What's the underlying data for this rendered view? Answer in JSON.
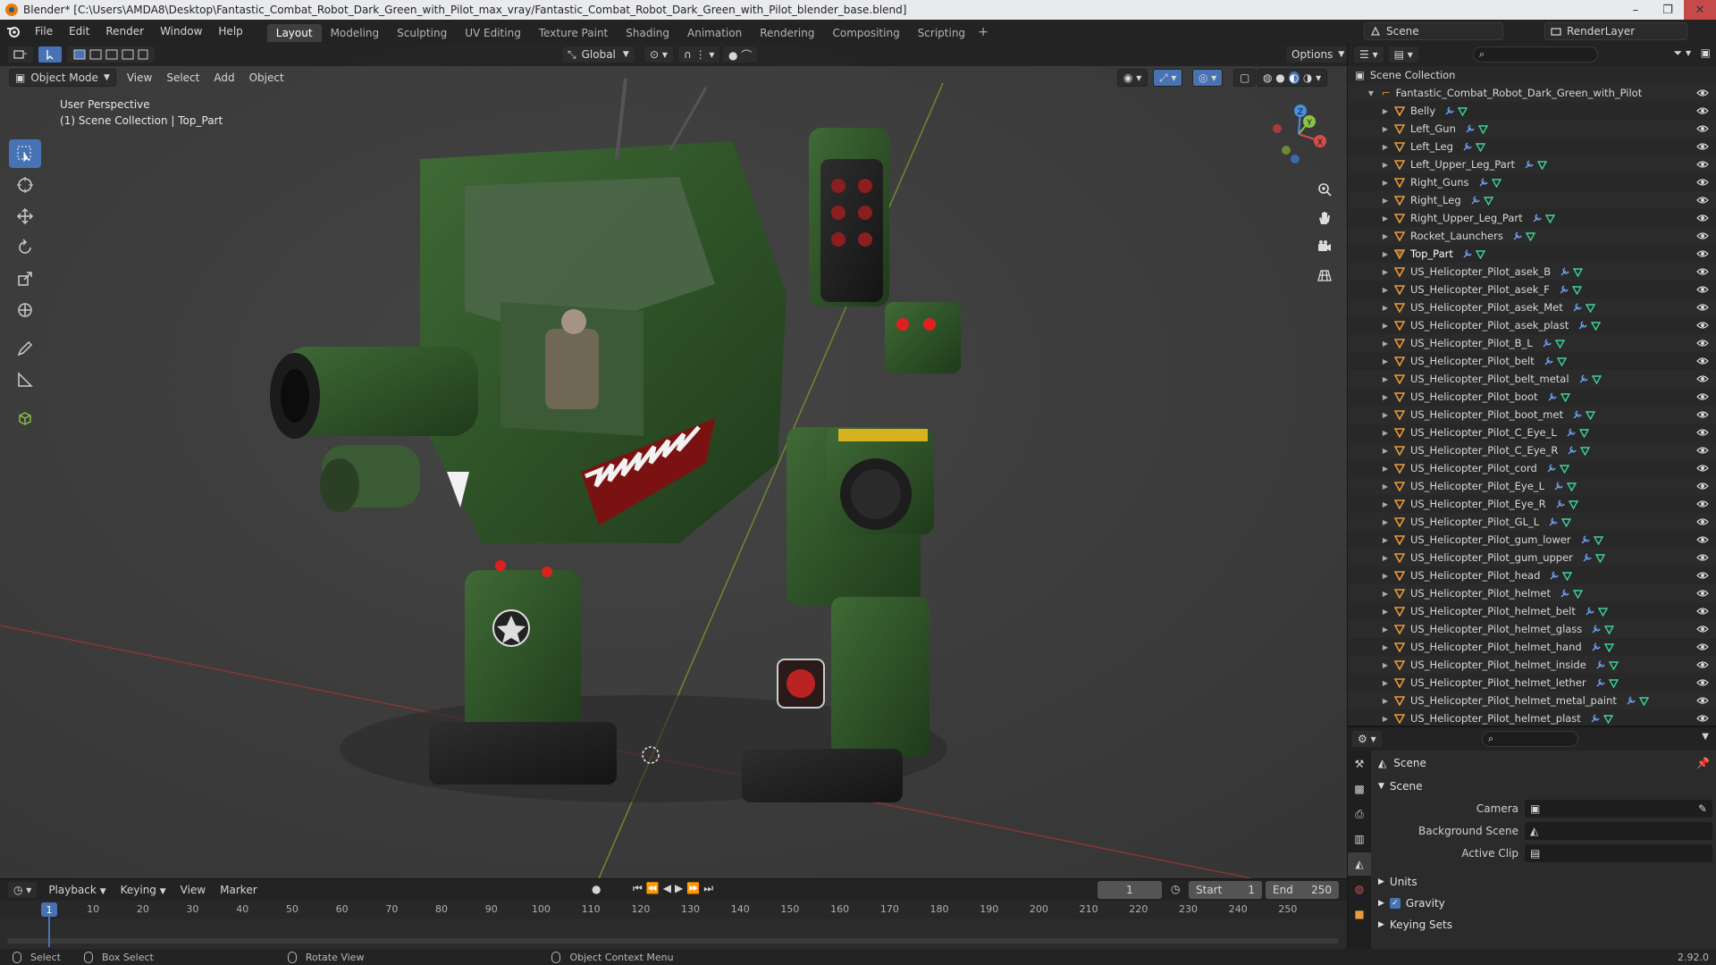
{
  "window": {
    "title": "Blender* [C:\\Users\\AMDA8\\Desktop\\Fantastic_Combat_Robot_Dark_Green_with_Pilot_max_vray/Fantastic_Combat_Robot_Dark_Green_with_Pilot_blender_base.blend]",
    "minimize": "–",
    "maximize": "❐",
    "close": "✕"
  },
  "menubar": {
    "items": [
      "File",
      "Edit",
      "Render",
      "Window",
      "Help"
    ]
  },
  "workspaces": {
    "tabs": [
      "Layout",
      "Modeling",
      "Sculpting",
      "UV Editing",
      "Texture Paint",
      "Shading",
      "Animation",
      "Rendering",
      "Compositing",
      "Scripting"
    ],
    "active": "Layout",
    "add": "+"
  },
  "scene_selector": {
    "value": "Scene"
  },
  "render_layer": {
    "value": "RenderLayer"
  },
  "viewport": {
    "mode": "Object Mode",
    "menus": [
      "View",
      "Select",
      "Add",
      "Object"
    ],
    "orientation": "Global",
    "options": "Options",
    "info_line1": "User Perspective",
    "info_line2": "(1) Scene Collection | Top_Part"
  },
  "gizmo": {
    "x": "X",
    "y": "Y",
    "z": "Z"
  },
  "outliner": {
    "root": "Scene Collection",
    "collection": "Fantastic_Combat_Robot_Dark_Green_with_Pilot",
    "objects": [
      "Belly",
      "Left_Gun",
      "Left_Leg",
      "Left_Upper_Leg_Part",
      "Right_Guns",
      "Right_Leg",
      "Right_Upper_Leg_Part",
      "Rocket_Launchers",
      "Top_Part",
      "US_Helicopter_Pilot_asek_B",
      "US_Helicopter_Pilot_asek_F",
      "US_Helicopter_Pilot_asek_Met",
      "US_Helicopter_Pilot_asek_plast",
      "US_Helicopter_Pilot_B_L",
      "US_Helicopter_Pilot_belt",
      "US_Helicopter_Pilot_belt_metal",
      "US_Helicopter_Pilot_boot",
      "US_Helicopter_Pilot_boot_met",
      "US_Helicopter_Pilot_C_Eye_L",
      "US_Helicopter_Pilot_C_Eye_R",
      "US_Helicopter_Pilot_cord",
      "US_Helicopter_Pilot_Eye_L",
      "US_Helicopter_Pilot_Eye_R",
      "US_Helicopter_Pilot_GL_L",
      "US_Helicopter_Pilot_gum_lower",
      "US_Helicopter_Pilot_gum_upper",
      "US_Helicopter_Pilot_head",
      "US_Helicopter_Pilot_helmet",
      "US_Helicopter_Pilot_helmet_belt",
      "US_Helicopter_Pilot_helmet_glass",
      "US_Helicopter_Pilot_helmet_hand",
      "US_Helicopter_Pilot_helmet_inside",
      "US_Helicopter_Pilot_helmet_lether",
      "US_Helicopter_Pilot_helmet_metal_paint",
      "US_Helicopter_Pilot_helmet_plast"
    ],
    "active_object": "Top_Part"
  },
  "properties": {
    "context": "Scene",
    "panel": "Scene",
    "camera_label": "Camera",
    "background_scene_label": "Background Scene",
    "active_clip_label": "Active Clip",
    "collapsed_panels": [
      "Units",
      "Gravity",
      "Keying Sets"
    ],
    "gravity_enabled": true,
    "gravity_check": "✓"
  },
  "timeline": {
    "menus": [
      "Playback",
      "Keying",
      "View",
      "Marker"
    ],
    "current_frame": "1",
    "start_label": "Start",
    "start_value": "1",
    "end_label": "End",
    "end_value": "250",
    "ticks": [
      "10",
      "20",
      "30",
      "40",
      "50",
      "60",
      "70",
      "80",
      "90",
      "100",
      "110",
      "120",
      "130",
      "140",
      "150",
      "160",
      "170",
      "180",
      "190",
      "200",
      "210",
      "220",
      "230",
      "240",
      "250"
    ],
    "marker": "1"
  },
  "statusbar": {
    "select": "Select",
    "box_select": "Box Select",
    "rotate_view": "Rotate View",
    "context_menu": "Object Context Menu",
    "version": "2.92.0"
  },
  "colors": {
    "accent": "#4772b3",
    "object_orange": "#e89a3c",
    "mesh_green": "#3ed29a",
    "modifier_blue": "#6c9ff0",
    "axis_x": "#d44c4c",
    "axis_y": "#8bc34a",
    "axis_z": "#4a8fe0",
    "robot_green": "#2f4f2a"
  }
}
